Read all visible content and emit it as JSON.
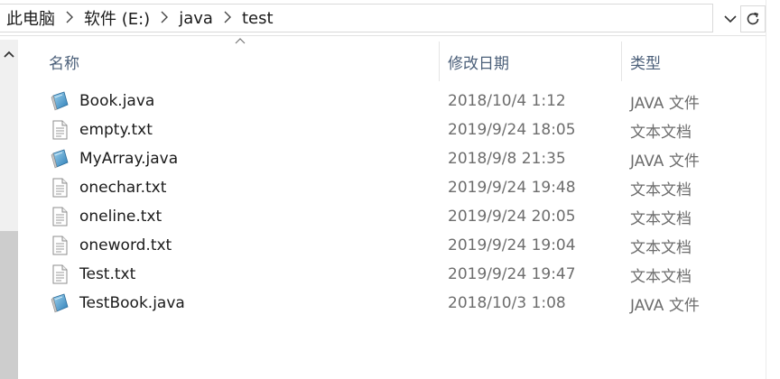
{
  "address": {
    "crumbs": [
      "此电脑",
      "软件 (E:)",
      "java",
      "test"
    ],
    "separator_icon": "chevron-right-icon"
  },
  "columns": {
    "name": "名称",
    "date": "修改日期",
    "type": "类型"
  },
  "files": [
    {
      "name": "Book.java",
      "date": "2018/10/4 1:12",
      "type": "JAVA 文件",
      "icon": "java-file-icon"
    },
    {
      "name": "empty.txt",
      "date": "2019/9/24 18:05",
      "type": "文本文档",
      "icon": "text-file-icon"
    },
    {
      "name": "MyArray.java",
      "date": "2018/9/8 21:35",
      "type": "JAVA 文件",
      "icon": "java-file-icon"
    },
    {
      "name": "onechar.txt",
      "date": "2019/9/24 19:48",
      "type": "文本文档",
      "icon": "text-file-icon"
    },
    {
      "name": "oneline.txt",
      "date": "2019/9/24 20:05",
      "type": "文本文档",
      "icon": "text-file-icon"
    },
    {
      "name": "oneword.txt",
      "date": "2019/9/24 19:04",
      "type": "文本文档",
      "icon": "text-file-icon"
    },
    {
      "name": "Test.txt",
      "date": "2019/9/24 19:47",
      "type": "文本文档",
      "icon": "text-file-icon"
    },
    {
      "name": "TestBook.java",
      "date": "2018/10/3 1:08",
      "type": "JAVA 文件",
      "icon": "java-file-icon"
    }
  ],
  "colors": {
    "header_text": "#4c607a",
    "meta_text": "#6d6d6d"
  }
}
